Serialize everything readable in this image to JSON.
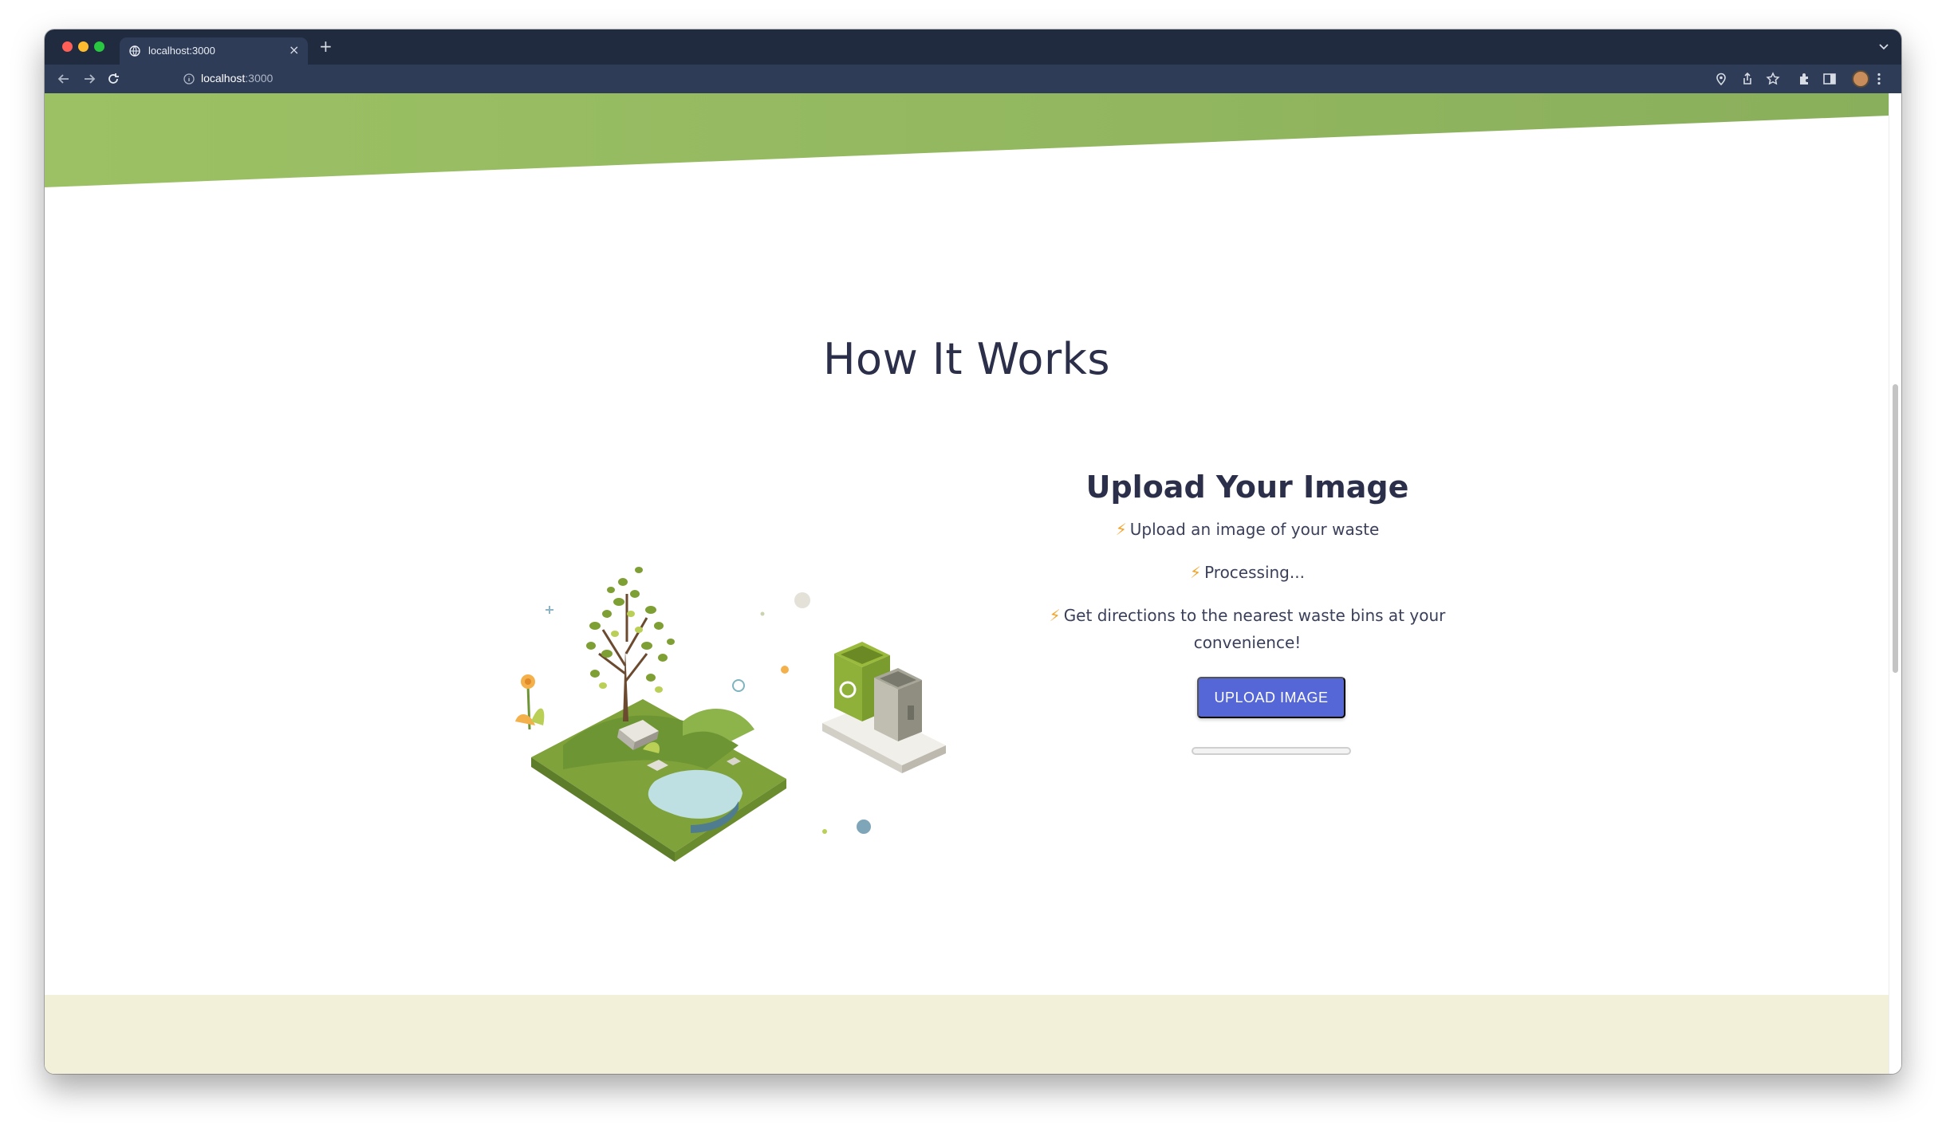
{
  "browser": {
    "tab_title": "localhost:3000",
    "new_tab_label": "+",
    "tab_close": "×",
    "url_host": "localhost",
    "url_port": ":3000"
  },
  "page": {
    "section_title": "How It Works",
    "step": {
      "title": "Upload Your Image",
      "bolt": "⚡",
      "lines": [
        "Upload an image of your waste",
        "Processing...",
        "Get directions to the nearest waste bins at your",
        "convenience!"
      ],
      "button_label": "UPLOAD IMAGE",
      "progress_fraction": 0
    }
  },
  "colors": {
    "hero_green": "#8fb85e",
    "footer_cream": "#f2f0d8",
    "accent_button": "#5566d6",
    "bolt": "#f4a32a",
    "title_text": "#2b2f4a"
  },
  "icons": {
    "tab_favicon": "globe-icon",
    "back": "arrow-left-icon",
    "forward": "arrow-right-icon",
    "reload": "reload-icon",
    "site_info": "info-icon",
    "location": "location-pin-icon",
    "share": "share-icon",
    "bookmark": "star-icon",
    "extensions": "puzzle-icon",
    "side_panel": "side-panel-icon",
    "menu": "kebab-menu-icon",
    "tab_list": "chevron-down-icon"
  }
}
